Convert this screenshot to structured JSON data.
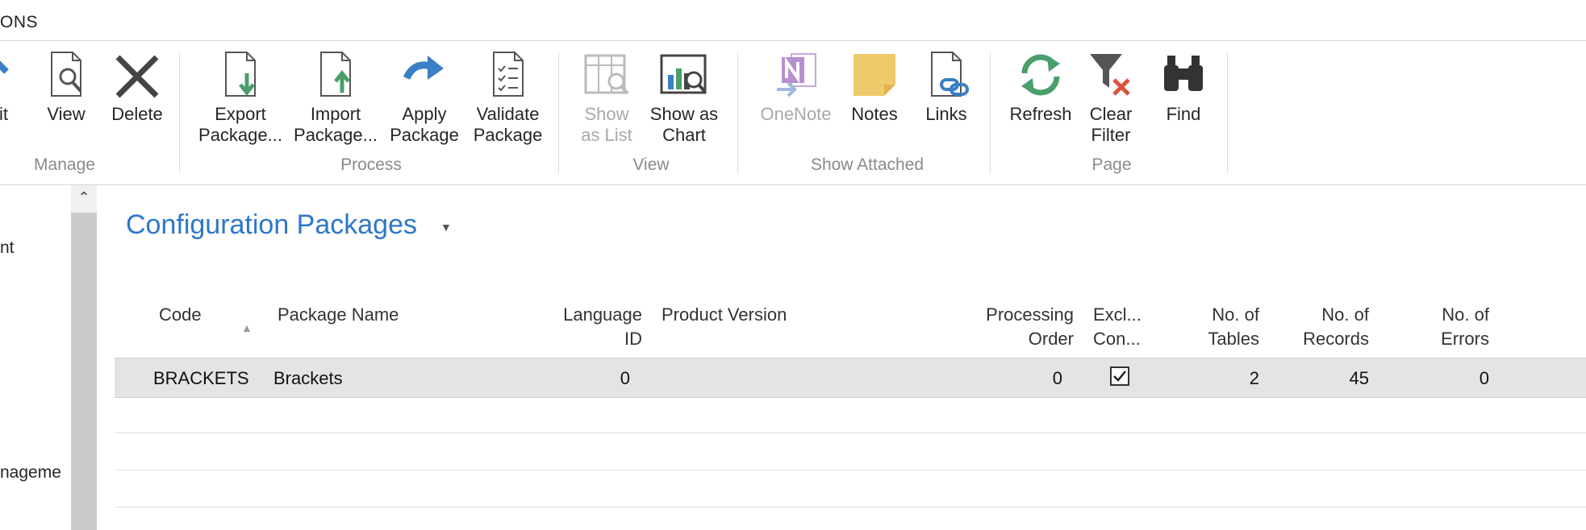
{
  "top_tab": "ONS",
  "ribbon": {
    "buttons": {
      "edit": "it",
      "view": "View",
      "delete": "Delete",
      "export_l1": "Export",
      "export_l2": "Package...",
      "import_l1": "Import",
      "import_l2": "Package...",
      "apply_l1": "Apply",
      "apply_l2": "Package",
      "validate_l1": "Validate",
      "validate_l2": "Package",
      "showlist_l1": "Show",
      "showlist_l2": "as List",
      "showchart_l1": "Show as",
      "showchart_l2": "Chart",
      "onenote": "OneNote",
      "notes": "Notes",
      "links": "Links",
      "refresh": "Refresh",
      "clear_l1": "Clear",
      "clear_l2": "Filter",
      "find": "Find"
    },
    "groups": {
      "manage": "Manage",
      "process": "Process",
      "view": "View",
      "show_attached": "Show Attached",
      "page": "Page"
    }
  },
  "leftnav": {
    "item1": "nt",
    "item2": "nageme"
  },
  "page_title": "Configuration Packages",
  "columns": {
    "code": "Code",
    "package_name": "Package Name",
    "language_l1": "Language",
    "language_l2": "ID",
    "product_version": "Product Version",
    "processing_l1": "Processing",
    "processing_l2": "Order",
    "excl_l1": "Excl...",
    "excl_l2": "Con...",
    "tables_l1": "No. of",
    "tables_l2": "Tables",
    "records_l1": "No. of",
    "records_l2": "Records",
    "errors_l1": "No. of",
    "errors_l2": "Errors"
  },
  "rows": [
    {
      "code": "BRACKETS",
      "package_name": "Brackets",
      "language_id": "0",
      "product_version": "",
      "processing_order": "0",
      "exclude_config": true,
      "no_of_tables": "2",
      "no_of_records": "45",
      "no_of_errors": "0"
    }
  ],
  "colors": {
    "title": "#2e78c8",
    "selected_row": "#e4e4e4"
  }
}
